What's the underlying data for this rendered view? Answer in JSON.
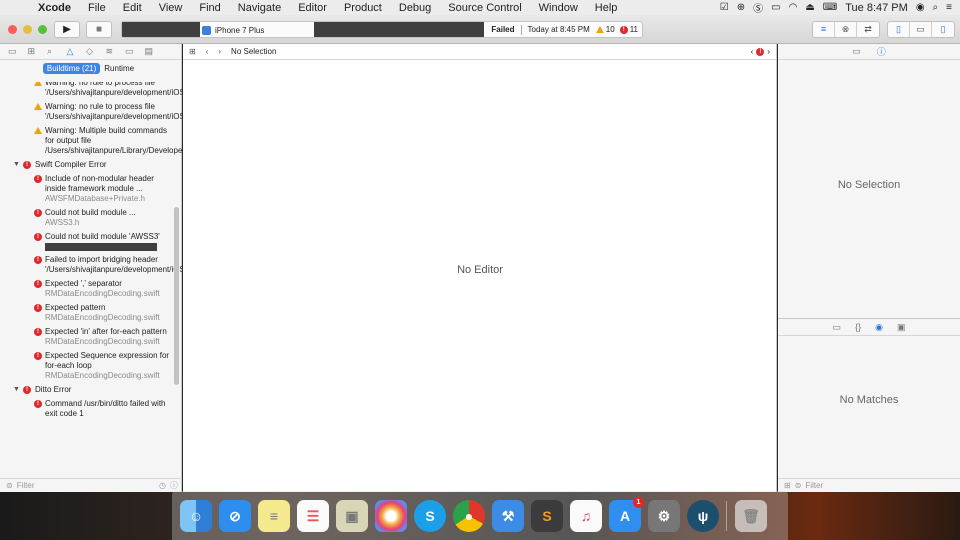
{
  "menubar": {
    "apple": "",
    "items": [
      "Xcode",
      "File",
      "Edit",
      "View",
      "Find",
      "Navigate",
      "Editor",
      "Product",
      "Debug",
      "Source Control",
      "Window",
      "Help"
    ],
    "time": "Tue 8:47 PM"
  },
  "toolbar": {
    "device": "iPhone 7 Plus",
    "status": "Failed",
    "status_time": "Today at 8:45 PM",
    "warnings": "10",
    "errors": "11"
  },
  "navigator": {
    "tabs": [
      "Buildtime (21)",
      "Runtime"
    ],
    "issues": [
      {
        "type": "warning",
        "text": "Warning: no rule to process file '/Users/shivajitanpure/development/iOS/backup/..."
      },
      {
        "type": "warning",
        "text": "Warning: no rule to process file '/Users/shivajitanpure/development/iOS/backup/..."
      },
      {
        "type": "warning",
        "text": "Warning: Multiple build commands for output file /Users/shivajitanpure/Library/Develope..."
      }
    ],
    "group1": "Swift Compiler Error",
    "group1_issues": [
      {
        "text": "Include of non-modular header inside framework module ...",
        "file": "AWSFMDatabase+Private.h"
      },
      {
        "text": "Could not build module ...",
        "file": "AWSS3.h"
      },
      {
        "text": "Could not build module 'AWSS3'",
        "file": ""
      },
      {
        "text": "Failed to import bridging header '/Users/shivajitanpure/development/iOS/backup/...",
        "file": ""
      },
      {
        "text": "Expected ',' separator",
        "file": "RMDataEncodingDecoding.swift"
      },
      {
        "text": "Expected pattern",
        "file": "RMDataEncodingDecoding.swift"
      },
      {
        "text": "Expected 'in' after for-each pattern",
        "file": "RMDataEncodingDecoding.swift"
      },
      {
        "text": "Expected Sequence expression for for-each loop",
        "file": "RMDataEncodingDecoding.swift"
      }
    ],
    "group2": "Ditto Error",
    "group2_issues": [
      {
        "text": "Command /usr/bin/ditto failed with exit code 1",
        "file": ""
      }
    ],
    "filter_placeholder": "Filter"
  },
  "editor": {
    "jump_label": "No Selection",
    "empty_label": "No Editor"
  },
  "inspector": {
    "no_selection": "No Selection",
    "no_matches": "No Matches",
    "filter_placeholder": "Filter"
  },
  "dock": {
    "app_store_badge": "1"
  }
}
